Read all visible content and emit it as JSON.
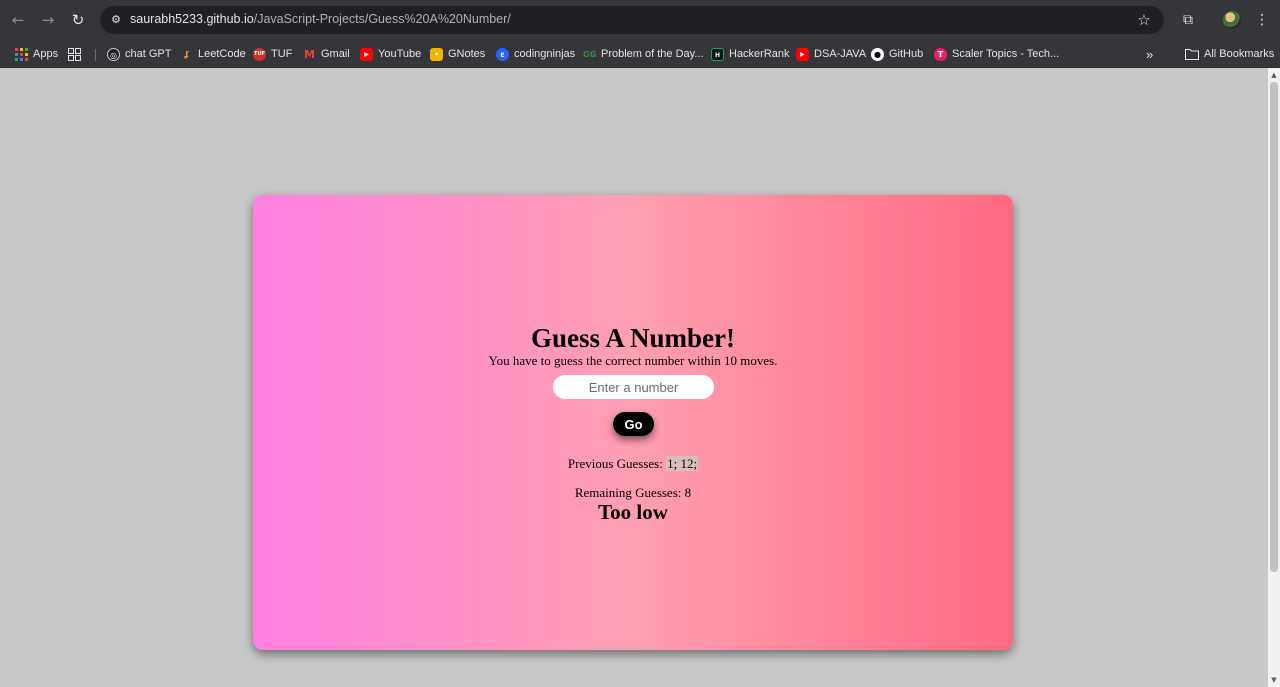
{
  "browser": {
    "url_host": "saurabh5233.github.io",
    "url_path": "/JavaScript-Projects/Guess%20A%20Number/",
    "bookmarks": [
      {
        "label": "Apps",
        "icon": "apps-grid-icon",
        "color": "#e94235"
      },
      {
        "label": "chat GPT",
        "icon": "chatgpt-icon",
        "color": "#202124"
      },
      {
        "label": "LeetCode",
        "icon": "leetcode-icon",
        "color": "#f0a030"
      },
      {
        "label": "TUF",
        "icon": "tuf-icon",
        "color": "#d32f2f"
      },
      {
        "label": "Gmail",
        "icon": "gmail-icon",
        "color": "#ea4335"
      },
      {
        "label": "YouTube",
        "icon": "youtube-icon",
        "color": "#ff0000"
      },
      {
        "label": "GNotes",
        "icon": "gnotes-icon",
        "color": "#f4b400"
      },
      {
        "label": "codingninjas",
        "icon": "codingninjas-icon",
        "color": "#2962ff"
      },
      {
        "label": "Problem of the Day...",
        "icon": "gfg-icon",
        "color": "#2f8d46"
      },
      {
        "label": "HackerRank",
        "icon": "hackerrank-icon",
        "color": "#1ba94c"
      },
      {
        "label": "DSA-JAVA",
        "icon": "youtube-icon",
        "color": "#ff0000"
      },
      {
        "label": "GitHub",
        "icon": "github-icon",
        "color": "#ffffff"
      },
      {
        "label": "Scaler Topics - Tech...",
        "icon": "scaler-icon",
        "color": "#e91e63"
      }
    ],
    "all_bookmarks_label": "All Bookmarks"
  },
  "game": {
    "title": "Guess A Number!",
    "subtitle": "You have to guess the correct number within 10 moves.",
    "input_placeholder": "Enter a number",
    "go_label": "Go",
    "previous_label": "Previous Guesses:",
    "previous_values": "1; 12;",
    "remaining_label": "Remaining Guesses:",
    "remaining_value": "8",
    "result": "Too low"
  },
  "colors": {
    "gradient_left": "#ff80e0",
    "gradient_mid": "#ff9fb2",
    "gradient_right": "#ff6a80",
    "page_bg": "#c8c8c8"
  }
}
